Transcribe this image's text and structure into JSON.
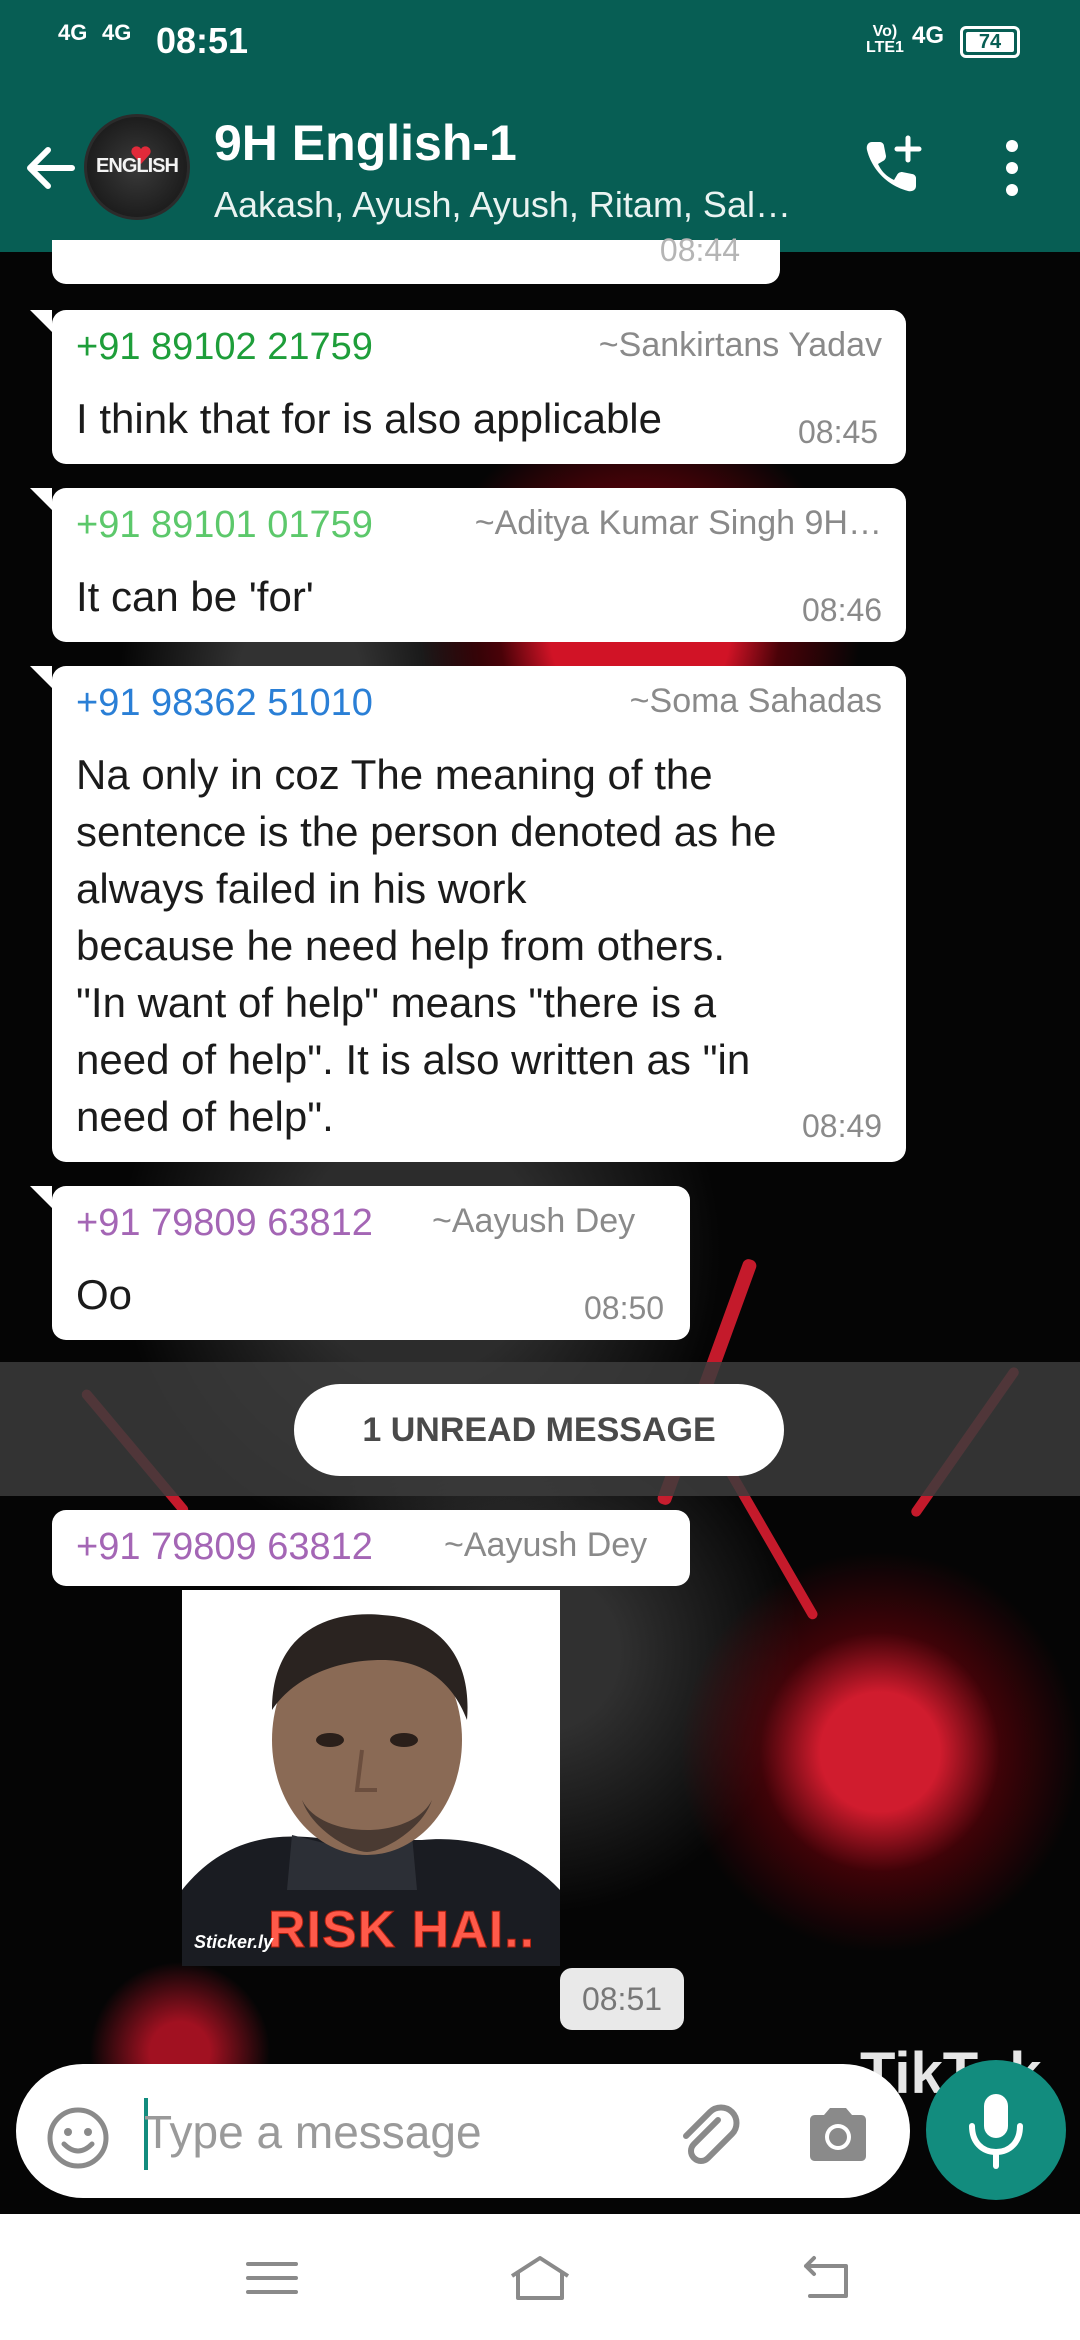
{
  "status": {
    "signal1": "4G",
    "signal2": "4G",
    "time": "08:51",
    "volte_top": "Vo)",
    "volte_bottom": "LTE1",
    "network": "4G",
    "battery": "74"
  },
  "header": {
    "group_name": "9H English-1",
    "members": "Aakash, Ayush, Ayush, Ritam, Sal…",
    "avatar_text": "ENGLISH"
  },
  "messages": [
    {
      "partial_time": "08:44"
    },
    {
      "sender": "+91 89102 21759",
      "sender_color": "#1e9e3a",
      "alias": "~Sankirtans Yadav",
      "text": "I think that for is also applicable",
      "time": "08:45"
    },
    {
      "sender": "+91 89101 01759",
      "sender_color": "#5cc86b",
      "alias": "~Aditya Kumar Singh 9H…",
      "text": "It can be 'for'",
      "time": "08:46"
    },
    {
      "sender": "+91 98362 51010",
      "sender_color": "#2a7fd6",
      "alias": "~Soma Sahadas",
      "lines": [
        "Na only in coz The meaning of the",
        "sentence is the person denoted as he",
        "always failed in his work",
        "because he need help from others.",
        "\"In want of help\" means \"there is a",
        "need of help\". It is also written as \"in",
        "need of help\"."
      ],
      "time": "08:49"
    },
    {
      "sender": "+91 79809 63812",
      "sender_color": "#a466b5",
      "alias": "~Aayush Dey",
      "text": "Oo",
      "time": "08:50"
    },
    {
      "sender": "+91 79809 63812",
      "sender_color": "#a466b5",
      "alias": "~Aayush Dey",
      "time": "08:51"
    }
  ],
  "unread_label": "1 UNREAD MESSAGE",
  "sticker": {
    "caption": "RISK HAI..",
    "brand": "Sticker.ly"
  },
  "composer": {
    "placeholder": "Type a message"
  },
  "watermark": "TikTok"
}
